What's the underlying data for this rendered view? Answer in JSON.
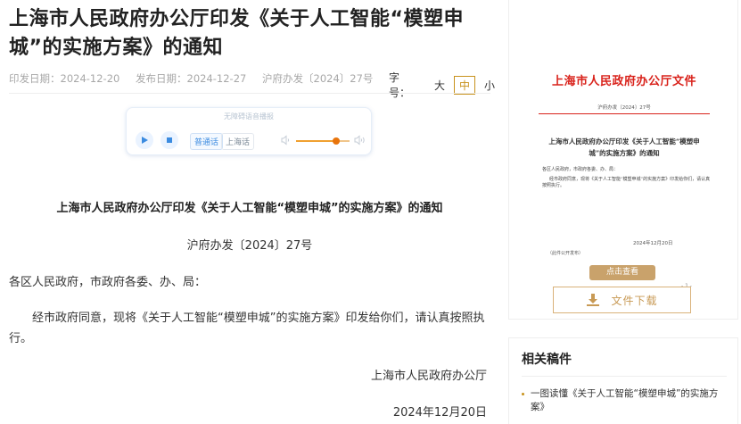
{
  "article": {
    "title": "上海市人民政府办公厅印发《关于人工智能“模塑申城”的实施方案》的通知",
    "meta": {
      "issue_date": "印发日期：2024-12-20",
      "publish_date": "发布日期：2024-12-27",
      "doc_number": "沪府办发〔2024〕27号"
    },
    "font_size": {
      "label": "字号：",
      "options": [
        "大",
        "中",
        "小"
      ],
      "selected": "中"
    },
    "player": {
      "caption": "无障碍语音播报",
      "languages": [
        "普通话",
        "上海话"
      ],
      "selected_language": "普通话",
      "volume_level": 0.75
    },
    "body": {
      "heading": "上海市人民政府办公厅印发《关于人工智能“模塑申城”的实施方案》的通知",
      "doc_number": "沪府办发〔2024〕27号",
      "salutation": "各区人民政府，市政府各委、办、局：",
      "paragraph": "经市政府同意，现将《关于人工智能“模塑申城”的实施方案》印发给你们，请认真按照执行。",
      "signature": "上海市人民政府办公厅",
      "date": "2024年12月20日"
    }
  },
  "sidebar": {
    "doc_preview": {
      "org_header": "上海市人民政府办公厅文件",
      "doc_number": "沪府办发〔2024〕27号",
      "title": "上海市人民政府办公厅印发《关于人工智能“模塑申城”的实施方案》的通知",
      "salutation": "各区人民政府，市政府各委、办、局：",
      "body": "经市政府同意，现将《关于人工智能“模塑申城”的实施方案》印发给你们，请认真按照执行。",
      "date": "2024年12月20日",
      "note": "（此件公开发布）",
      "page_marker": "- 1 -"
    },
    "view_button": "点击查看",
    "download_button": "文件下载",
    "related": {
      "title": "相关稿件",
      "items": [
        "一图读懂《关于人工智能“模塑申城”的实施方案》"
      ]
    }
  },
  "colors": {
    "accent_gold": "#c8921c",
    "doc_red": "#d9221b",
    "player_blue": "#3b8be0",
    "volume_orange": "#e8740c"
  }
}
